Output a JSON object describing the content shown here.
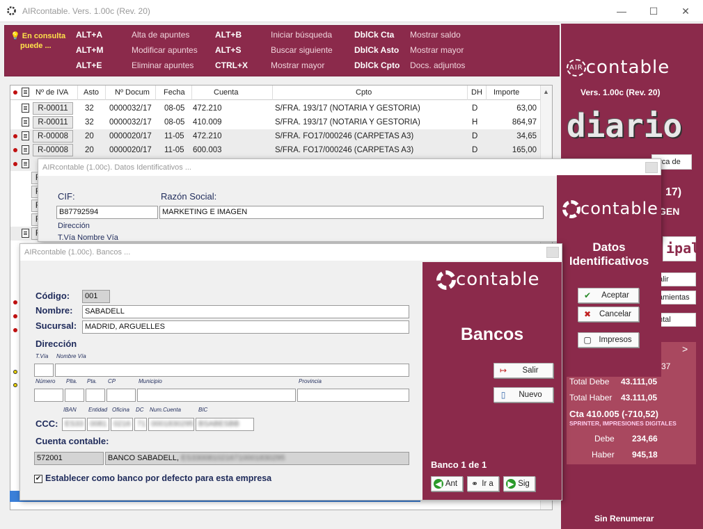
{
  "window": {
    "title": "AIRcontable. Vers. 1.00c (Rev. 20)",
    "minimize_glyph": "—",
    "maximize_glyph": "☐",
    "close_glyph": "✕"
  },
  "shortcuts": {
    "hint_line1": "En consulta",
    "hint_line2": "puede ...",
    "items": [
      {
        "key": "ALT+A",
        "desc": "Alta de apuntes"
      },
      {
        "key": "ALT+M",
        "desc": "Modificar apuntes"
      },
      {
        "key": "ALT+E",
        "desc": "Eliminar apuntes"
      },
      {
        "key": "ALT+B",
        "desc": "Iniciar búsqueda"
      },
      {
        "key": "ALT+S",
        "desc": "Buscar siguiente"
      },
      {
        "key": "CTRL+X",
        "desc": "Mostrar mayor"
      },
      {
        "key": "DblCk Cta",
        "desc": "Mostrar saldo"
      },
      {
        "key": "DblCk Asto",
        "desc": "Mostrar mayor"
      },
      {
        "key": "DblCk Cpto",
        "desc": "Docs. adjuntos"
      }
    ]
  },
  "grid": {
    "headers": [
      "Nº de IVA",
      "Asto",
      "Nº Docum",
      "Fecha",
      "Cuenta",
      "Cpto",
      "DH",
      "Importe"
    ],
    "rows": [
      {
        "iva": "R-00011",
        "asto": "32",
        "docum": "0000032/17",
        "fecha": "08-05",
        "cuenta": "472.210",
        "cpto": "S/FRA. 193/17 (NOTARIA Y GESTORIA)",
        "dh": "D",
        "importe": "63,00"
      },
      {
        "iva": "R-00011",
        "asto": "32",
        "docum": "0000032/17",
        "fecha": "08-05",
        "cuenta": "410.009",
        "cpto": "S/FRA. 193/17 (NOTARIA Y GESTORIA)",
        "dh": "H",
        "importe": "864,97"
      },
      {
        "iva": "R-00008",
        "asto": "20",
        "docum": "0000020/17",
        "fecha": "11-05",
        "cuenta": "472.210",
        "cpto": "S/FRA. FO17/000246 (CARPETAS A3)",
        "dh": "D",
        "importe": "34,65"
      },
      {
        "iva": "R-00008",
        "asto": "20",
        "docum": "0000020/17",
        "fecha": "11-05",
        "cuenta": "600.003",
        "cpto": "S/FRA. FO17/000246 (CARPETAS A3)",
        "dh": "D",
        "importe": "165,00"
      }
    ],
    "partial_iva": "R"
  },
  "right_panel": {
    "logo_prefix": "AIR",
    "logo": "contable",
    "version": "Vers. 1.00c (Rev. 20)",
    "module": "diario",
    "search_label": "erca de",
    "year_frag": "17)",
    "company_frag": "GEN",
    "ipal_frag": "ipal",
    "btn_salir": "alir",
    "btn_amientas": "amientas",
    "btn_ntal": "ntal",
    "arrow": ">",
    "stat_frag": "37",
    "total_debe_label": "Total Debe",
    "total_debe": "43.111,05",
    "total_haber_label": "Total Haber",
    "total_haber": "43.111,05",
    "cta": "Cta 410.005 (-710,52)",
    "cta_name": "SPRINTER, IMPRESIONES DIGITALES",
    "debe_label": "Debe",
    "debe": "234,66",
    "haber_label": "Haber",
    "haber": "945,18",
    "footer": "Sin Renumerar"
  },
  "dlg_ident": {
    "title": "AIRcontable (1.00c). Datos Identificativos ...",
    "cif_label": "CIF:",
    "cif": "B87792594",
    "razon_label": "Razón Social:",
    "razon": "MARKETING E IMAGEN",
    "direccion_label": "Dirección",
    "tvia_label": "T.Vía Nombre Vía",
    "side_logo": "contable",
    "side_title_1": "Datos",
    "side_title_2": "Identificativos",
    "aceptar": "Aceptar",
    "cancelar": "Cancelar",
    "impresos": "Impresos"
  },
  "dlg_bancos": {
    "title": "AIRcontable (1.00c). Bancos ...",
    "codigo_label": "Código:",
    "codigo": "001",
    "nombre_label": "Nombre:",
    "nombre": "SABADELL",
    "sucursal_label": "Sucursal:",
    "sucursal": "MADRID, ARGUELLES",
    "direccion_label": "Dirección",
    "tvia_small": "T.Vía",
    "nombrevia_small": "Nombre Vía",
    "numero_small": "Número",
    "plta_small": "Plta.",
    "pta_small": "Pta.",
    "cp_small": "CP",
    "municipio_small": "Municipio",
    "provincia_small": "Provincia",
    "iban_small": "IBAN",
    "entidad_small": "Entidad",
    "oficina_small": "Oficina",
    "dc_small": "DC",
    "numcuenta_small": "Num.Cuenta",
    "bic_small": "BIC",
    "ccc_label": "CCC:",
    "ccc_iban": "ES33",
    "ccc_entidad": "0081",
    "ccc_oficina": "0216",
    "ccc_dc": "71",
    "ccc_num": "0001830295",
    "ccc_bic": "BSABESBB",
    "cuenta_label": "Cuenta contable:",
    "cuenta": "572001",
    "cuenta_nombre": "BANCO SABADELL,",
    "cuenta_nombre_hidden": "ES3300810216710001830295",
    "default_check": "Establecer como banco por defecto para esta empresa",
    "side_logo": "contable",
    "side_title": "Bancos",
    "salir": "Salir",
    "nuevo": "Nuevo",
    "counter": "Banco 1 de 1",
    "ant": "Ant",
    "ira": "Ir a",
    "sig": "Sig"
  }
}
